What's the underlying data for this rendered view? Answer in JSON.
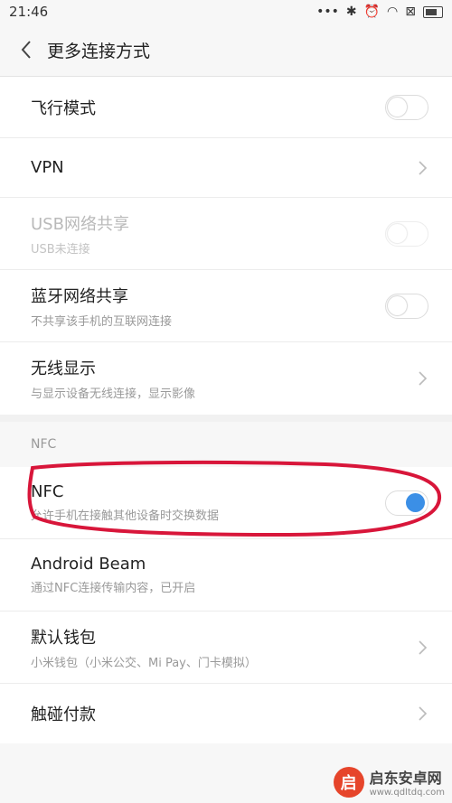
{
  "status_bar": {
    "time": "21:46",
    "dots": "•••",
    "bluetooth": "✱",
    "alarm": "⏰",
    "wifi": "◠",
    "sim": "⊠"
  },
  "header": {
    "title": "更多连接方式"
  },
  "rows_top": [
    {
      "label": "飞行模式",
      "type": "toggle",
      "on": false
    },
    {
      "label": "VPN",
      "type": "chevron"
    },
    {
      "label": "USB网络共享",
      "sub": "USB未连接",
      "type": "toggle",
      "on": false,
      "disabled": true
    },
    {
      "label": "蓝牙网络共享",
      "sub": "不共享该手机的互联网连接",
      "type": "toggle",
      "on": false
    },
    {
      "label": "无线显示",
      "sub": "与显示设备无线连接，显示影像",
      "type": "chevron"
    }
  ],
  "nfc_section": {
    "title": "NFC"
  },
  "rows_nfc": [
    {
      "label": "NFC",
      "sub": "允许手机在接触其他设备时交换数据",
      "type": "toggle",
      "on": true
    },
    {
      "label": "Android Beam",
      "sub": "通过NFC连接传输内容，已开启",
      "type": "none"
    },
    {
      "label": "默认钱包",
      "sub": "小米钱包（小米公交、Mi Pay、门卡模拟）",
      "type": "chevron"
    },
    {
      "label": "触碰付款",
      "type": "chevron"
    }
  ],
  "watermark": {
    "logo": "启",
    "name": "启东安卓网",
    "url": "www.qdltdq.com"
  },
  "colors": {
    "accent": "#3b8fe6",
    "highlight": "#d8163a"
  }
}
